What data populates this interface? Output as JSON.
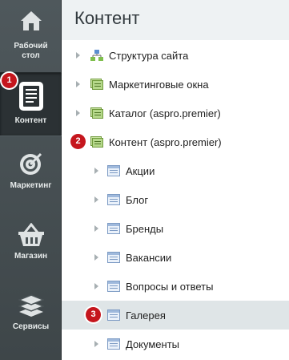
{
  "sidebar": {
    "items": [
      {
        "label_line1": "Рабочий",
        "label_line2": "стол",
        "icon": "home-icon"
      },
      {
        "label_line1": "Контент",
        "icon": "document-icon",
        "active": true,
        "badge": "1"
      },
      {
        "label_line1": "Маркетинг",
        "icon": "target-icon"
      },
      {
        "label_line1": "Магазин",
        "icon": "basket-icon"
      },
      {
        "label_line1": "Сервисы",
        "icon": "layers-icon"
      }
    ]
  },
  "panel": {
    "title": "Контент",
    "tree": [
      {
        "label": "Структура сайта",
        "icon": "sitemap-icon"
      },
      {
        "label": "Маркетинговые окна",
        "icon": "iblock-type-icon"
      },
      {
        "label": "Каталог (aspro.premier)",
        "icon": "iblock-type-icon"
      },
      {
        "label": "Контент (aspro.premier)",
        "icon": "iblock-type-icon",
        "badge": "2"
      },
      {
        "label": "Акции",
        "icon": "iblock-icon"
      },
      {
        "label": "Блог",
        "icon": "iblock-icon"
      },
      {
        "label": "Бренды",
        "icon": "iblock-icon"
      },
      {
        "label": "Вакансии",
        "icon": "iblock-icon"
      },
      {
        "label": "Вопросы и ответы",
        "icon": "iblock-icon"
      },
      {
        "label": "Галерея",
        "icon": "iblock-icon",
        "badge": "3",
        "selected": true
      },
      {
        "label": "Документы",
        "icon": "iblock-icon"
      }
    ]
  },
  "colors": {
    "sidebar_bg": "#4a5356",
    "badge": "#c5161d",
    "panel_bg": "#eef2f3",
    "selected_row": "#dfe5e7"
  }
}
